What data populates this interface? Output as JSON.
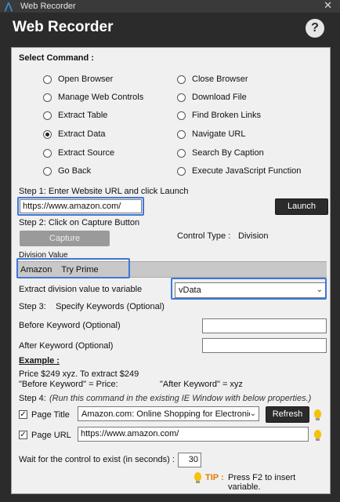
{
  "window": {
    "title": "Web Recorder",
    "close_glyph": "✕"
  },
  "header": {
    "title": "Web Recorder",
    "help_label": "?"
  },
  "commands": {
    "title": "Select Command :",
    "left": [
      "Open Browser",
      "Manage Web Controls",
      "Extract Table",
      "Extract Data",
      "Extract Source",
      "Go Back"
    ],
    "right": [
      "Close Browser",
      "Download File",
      "Find Broken Links",
      "Navigate URL",
      "Search By Caption",
      "Execute JavaScript Function"
    ],
    "selected": "Extract Data"
  },
  "step1": {
    "label": "Step 1: Enter Website URL and click Launch",
    "url": "https://www.amazon.com/",
    "launch_label": "Launch"
  },
  "step2": {
    "label": "Step 2: Click on Capture Button",
    "capture_label": "Capture",
    "control_type_label": "Control Type :",
    "control_type_value": "Division"
  },
  "division": {
    "label": "Division Value",
    "value": "Amazon    Try Prime"
  },
  "extract_var": {
    "label": "Extract division value to variable",
    "value": "vData"
  },
  "step3": {
    "label": "Step 3:    Specify Keywords (Optional)",
    "before_label": "Before Keyword (Optional)",
    "before_value": "",
    "after_label": "After Keyword (Optional)",
    "after_value": ""
  },
  "example": {
    "title": "Example :",
    "line1": "Price $249 xyz. To extract $249",
    "line2a": "\"Before Keyword\" = Price:",
    "line2b": "\"After Keyword\" = xyz"
  },
  "step4": {
    "label": "Step 4:",
    "note": "(Run this command in the existing IE Window with below properties.)",
    "page_title_label": "Page Title",
    "page_title_value": "Amazon.com: Online Shopping for Electronic",
    "page_title_checked": true,
    "refresh_label": "Refresh",
    "page_url_label": "Page URL",
    "page_url_value": "https://www.amazon.com/",
    "page_url_checked": true
  },
  "wait": {
    "label": "Wait for the control to exist (in seconds) :",
    "value": "30"
  },
  "tip": {
    "label": "TIP :",
    "text": "Press F2 to insert variable."
  },
  "colors": {
    "highlight": "#3d78d8",
    "dark": "#2b2b2b",
    "panel": "#f0f0f0",
    "bulb": "#f4c20d",
    "tip": "#e07b00"
  },
  "icons": {
    "help": "help-icon",
    "bulb": "lightbulb-icon",
    "chevron": "chevron-down-icon"
  }
}
